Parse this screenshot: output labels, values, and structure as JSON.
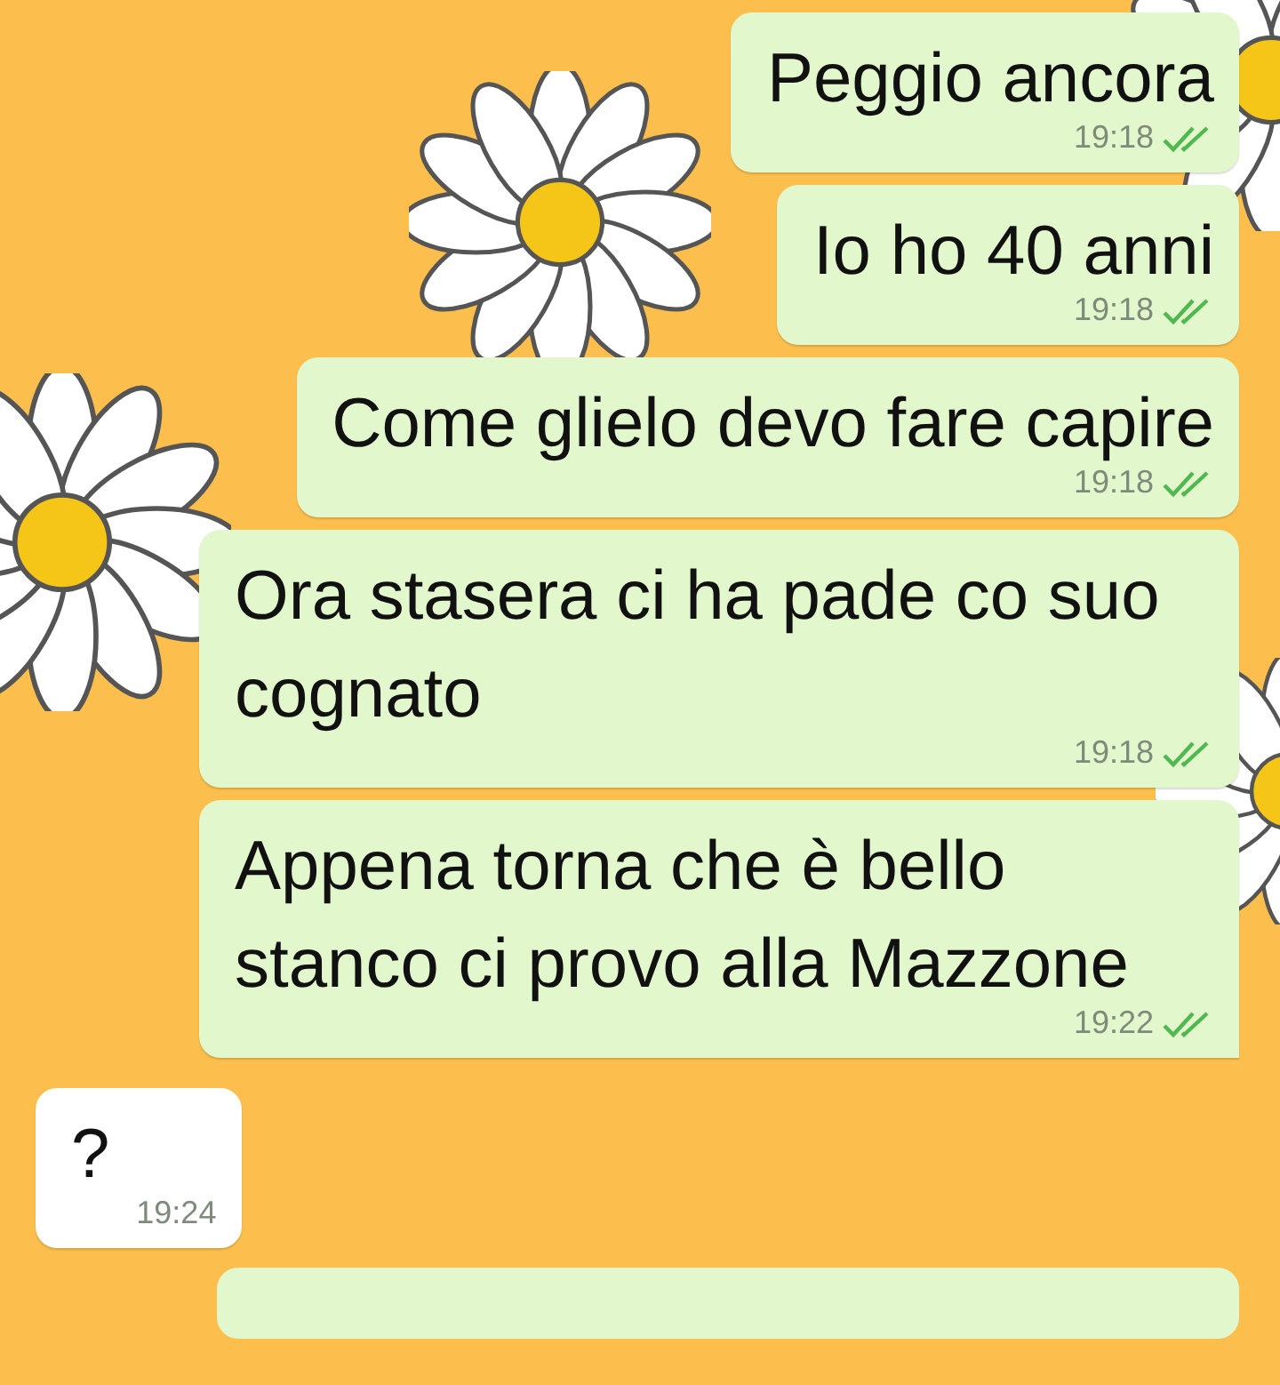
{
  "messages": [
    {
      "kind": "outgoing",
      "text": "Peggio ancora",
      "time": "19:18",
      "read": true
    },
    {
      "kind": "outgoing",
      "text": "Io ho 40 anni",
      "time": "19:18",
      "read": true
    },
    {
      "kind": "outgoing",
      "text": "Come glielo devo fare capire",
      "time": "19:18",
      "read": true
    },
    {
      "kind": "outgoing",
      "text": "Ora stasera ci ha pade co suo cognato",
      "time": "19:18",
      "read": true
    },
    {
      "kind": "outgoing",
      "text": "Appena torna che è bello stanco ci provo alla Mazzone",
      "time": "19:22",
      "read": true,
      "tail": true
    },
    {
      "kind": "incoming",
      "text": "?",
      "time": "19:24"
    }
  ],
  "partial_bubble_below": true
}
